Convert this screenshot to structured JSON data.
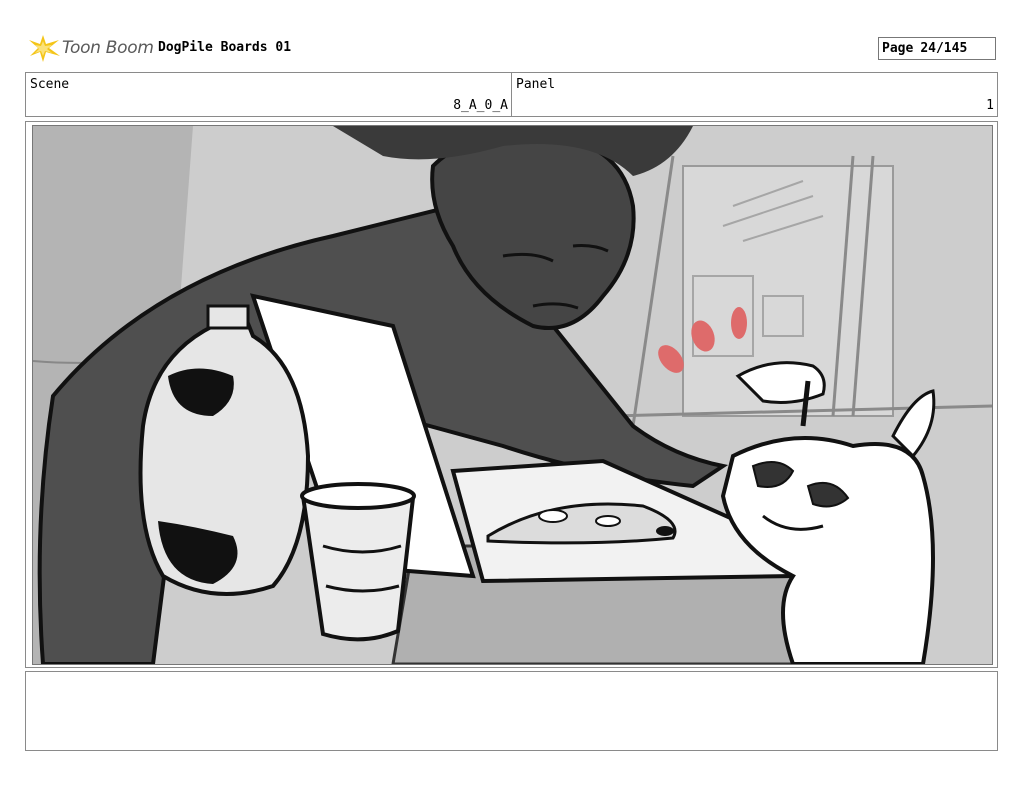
{
  "header": {
    "logo_text": "Toon Boom",
    "project_title": "DogPile Boards 01",
    "page_label": "Page",
    "page_number": "24/145"
  },
  "info": {
    "scene_label": "Scene",
    "scene_value": "8_A_0_A",
    "panel_label": "Panel",
    "panel_value": "1"
  },
  "notes": {
    "text": ""
  }
}
